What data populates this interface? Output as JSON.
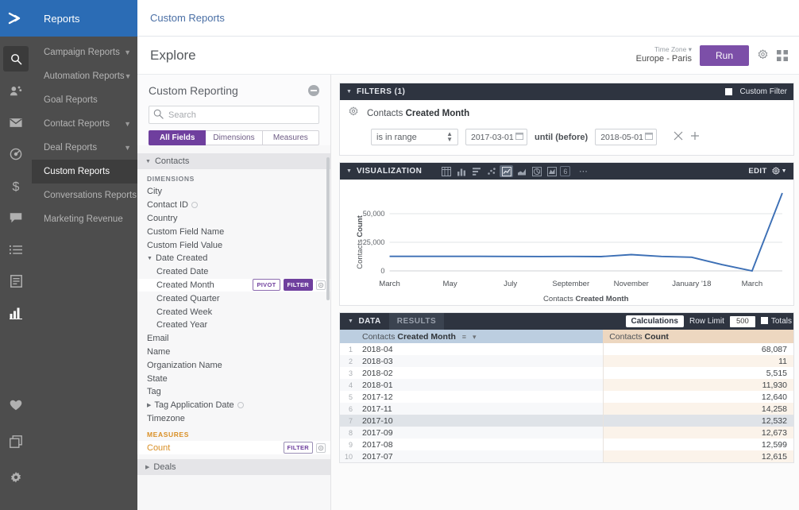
{
  "rail": {
    "logo_icon": "chevron-right-logo",
    "icons": [
      {
        "name": "search-icon",
        "selected": true
      },
      {
        "name": "contacts-icon",
        "selected": false
      },
      {
        "name": "email-icon",
        "selected": false
      },
      {
        "name": "automations-icon",
        "selected": false
      },
      {
        "name": "deals-dollar-icon",
        "selected": false
      },
      {
        "name": "conversations-icon",
        "selected": false
      },
      {
        "name": "lists-icon",
        "selected": false
      },
      {
        "name": "forms-icon",
        "selected": false
      },
      {
        "name": "reports-bar-icon",
        "selected": false,
        "active": true
      }
    ],
    "bottom_icons": [
      {
        "name": "heart-icon"
      },
      {
        "name": "apps-copy-icon"
      },
      {
        "name": "settings-gear-icon"
      }
    ]
  },
  "nav": {
    "title": "Reports",
    "items": [
      {
        "label": "Campaign Reports",
        "chevron": true,
        "active": false
      },
      {
        "label": "Automation Reports",
        "chevron": true,
        "active": false
      },
      {
        "label": "Goal Reports",
        "chevron": false,
        "active": false
      },
      {
        "label": "Contact Reports",
        "chevron": true,
        "active": false
      },
      {
        "label": "Deal Reports",
        "chevron": true,
        "active": false
      },
      {
        "label": "Custom Reports",
        "chevron": false,
        "active": true
      },
      {
        "label": "Conversations Reports",
        "chevron": false,
        "active": false
      },
      {
        "label": "Marketing Revenue",
        "chevron": false,
        "active": false
      }
    ]
  },
  "topbar": {
    "breadcrumb": "Custom Reports"
  },
  "explore": {
    "title": "Explore",
    "timezone_label": "Time Zone",
    "timezone_value": "Europe - Paris",
    "run_label": "Run",
    "gear_icon": "gear-icon",
    "grid_icon": "grid-icon"
  },
  "fieldpanel": {
    "title": "Custom Reporting",
    "collapse_icon": "collapse-minus-icon",
    "search_placeholder": "Search",
    "search_value": "",
    "search_icon": "search-icon",
    "segments": [
      {
        "label": "All Fields",
        "active": true
      },
      {
        "label": "Dimensions",
        "active": false
      },
      {
        "label": "Measures",
        "active": false
      }
    ],
    "groups": [
      {
        "name": "Contacts",
        "expanded": true,
        "sections": [
          {
            "label": "DIMENSIONS",
            "kind": "dimension",
            "fields": [
              {
                "label": "City"
              },
              {
                "label": "Contact ID",
                "info": true
              },
              {
                "label": "Country"
              },
              {
                "label": "Custom Field Name"
              },
              {
                "label": "Custom Field Value"
              },
              {
                "label": "Date Created",
                "expandable": true,
                "expanded": true
              },
              {
                "label": "Created Date",
                "indent": true
              },
              {
                "label": "Created Month",
                "indent": true,
                "selected": true,
                "tags": [
                  "PIVOT",
                  "FILTER"
                ],
                "gear": true
              },
              {
                "label": "Created Quarter",
                "indent": true
              },
              {
                "label": "Created Week",
                "indent": true
              },
              {
                "label": "Created Year",
                "indent": true
              },
              {
                "label": "Email"
              },
              {
                "label": "Name"
              },
              {
                "label": "Organization Name"
              },
              {
                "label": "State"
              },
              {
                "label": "Tag"
              },
              {
                "label": "Tag Application Date",
                "expandable": true,
                "info": true
              },
              {
                "label": "Timezone"
              }
            ]
          },
          {
            "label": "MEASURES",
            "kind": "measure",
            "fields": [
              {
                "label": "Count",
                "orange": true,
                "tags": [
                  "FILTER"
                ],
                "gear": true
              }
            ]
          }
        ]
      },
      {
        "name": "Deals",
        "expanded": false,
        "sections": []
      }
    ]
  },
  "filters": {
    "title": "FILTERS (1)",
    "custom_filter_label": "Custom Filter",
    "custom_filter_checked": false,
    "gear_icon": "gear-icon",
    "field_prefix": "Contacts",
    "field_name": "Created Month",
    "operator": "is in range",
    "date_from": "2017-03-01",
    "until_label": "until (before)",
    "date_to": "2018-05-01",
    "remove_icon": "close-x-icon",
    "add_icon": "plus-icon"
  },
  "visualization": {
    "title": "VISUALIZATION",
    "edit_label": "EDIT",
    "gear_icon": "gear-caret-icon",
    "types": [
      {
        "name": "table-viz-icon",
        "selected": false
      },
      {
        "name": "column-chart-icon",
        "selected": false
      },
      {
        "name": "bar-chart-icon",
        "selected": false
      },
      {
        "name": "scatter-chart-icon",
        "selected": false
      },
      {
        "name": "line-chart-icon",
        "selected": true
      },
      {
        "name": "area-chart-icon",
        "selected": false
      },
      {
        "name": "pie-chart-icon",
        "selected": false
      },
      {
        "name": "map-chart-icon",
        "selected": false
      },
      {
        "name": "single-value-icon",
        "selected": false,
        "label": "6"
      },
      {
        "name": "more-options-icon",
        "selected": false
      }
    ]
  },
  "chart_data": {
    "type": "line",
    "title": "",
    "xlabel_prefix": "Contacts",
    "xlabel_bold": "Created Month",
    "ylabel_prefix": "Contacts",
    "ylabel_bold": "Count",
    "ylim": [
      0,
      70000
    ],
    "yticks": [
      0,
      25000,
      50000
    ],
    "ytick_labels": [
      "0",
      "25,000",
      "50,000"
    ],
    "xtick_labels": [
      "March",
      "May",
      "July",
      "September",
      "November",
      "January '18",
      "March"
    ],
    "grid": true,
    "legend": "none",
    "line_color": "#3c6fb5",
    "x": [
      "2017-03",
      "2017-04",
      "2017-05",
      "2017-06",
      "2017-07",
      "2017-08",
      "2017-09",
      "2017-10",
      "2017-11",
      "2017-12",
      "2018-01",
      "2018-02",
      "2018-03",
      "2018-04"
    ],
    "values": [
      12700,
      12700,
      12700,
      12700,
      12615,
      12599,
      12673,
      12532,
      14258,
      12640,
      11930,
      5515,
      11,
      68087
    ]
  },
  "data": {
    "tab_data": "DATA",
    "tab_results": "RESULTS",
    "calculations_label": "Calculations",
    "row_limit_label": "Row Limit",
    "row_limit_value": "500",
    "totals_label": "Totals",
    "totals_checked": false,
    "columns": [
      {
        "prefix": "Contacts",
        "bold": "Created Month",
        "kind": "dimension",
        "sort_icon": "sort-descending-icon",
        "menu_icon": "chevron-down-icon"
      },
      {
        "prefix": "Contacts",
        "bold": "Count",
        "kind": "measure"
      }
    ],
    "rows": [
      {
        "index": "1",
        "month": "2018-04",
        "count": "68,087"
      },
      {
        "index": "2",
        "month": "2018-03",
        "count": "11"
      },
      {
        "index": "3",
        "month": "2018-02",
        "count": "5,515"
      },
      {
        "index": "4",
        "month": "2018-01",
        "count": "11,930"
      },
      {
        "index": "5",
        "month": "2017-12",
        "count": "12,640"
      },
      {
        "index": "6",
        "month": "2017-11",
        "count": "14,258"
      },
      {
        "index": "7",
        "month": "2017-10",
        "count": "12,532",
        "hover": true
      },
      {
        "index": "8",
        "month": "2017-09",
        "count": "12,673"
      },
      {
        "index": "9",
        "month": "2017-08",
        "count": "12,599"
      },
      {
        "index": "10",
        "month": "2017-07",
        "count": "12,615"
      }
    ]
  },
  "colors": {
    "brand_blue": "#2b6cb5",
    "accent_purple": "#6f3f9e",
    "dark_header": "#2e3440",
    "measure_orange": "#d98f25",
    "line_blue": "#3c6fb5"
  }
}
